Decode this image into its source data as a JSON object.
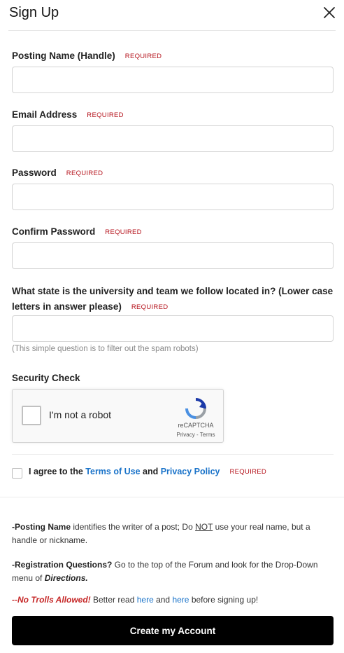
{
  "dialog": {
    "title": "Sign Up"
  },
  "form": {
    "required_tag": "REQUIRED",
    "fields": [
      {
        "label": "Posting Name (Handle)",
        "value": "",
        "placeholder": ""
      },
      {
        "label": "Email Address",
        "value": "",
        "placeholder": ""
      },
      {
        "label": "Password",
        "value": "",
        "placeholder": ""
      },
      {
        "label": "Confirm Password",
        "value": "",
        "placeholder": ""
      },
      {
        "label_line1": "What state is the university and team we follow located in? (Lower case",
        "label_line2": "letters in answer please)",
        "value": "",
        "placeholder": "",
        "hint": "(This simple question is to filter out the spam robots)"
      }
    ],
    "security_check_label": "Security Check"
  },
  "recaptcha": {
    "label": "I'm not a robot",
    "brand": "reCAPTCHA",
    "privacy": "Privacy",
    "sep": " - ",
    "terms": "Terms"
  },
  "agree": {
    "prefix": "I agree to the ",
    "terms_link": "Terms of Use",
    "and": " and ",
    "privacy_link": "Privacy Policy",
    "required": "REQUIRED"
  },
  "notes": {
    "posting_name_bold": "-Posting Name",
    "posting_name_text1": " identifies the writer of a post; Do ",
    "posting_name_not": "NOT",
    "posting_name_text2": " use your real name, but a handle or nickname.",
    "registration_bold": "-Registration Questions?",
    "registration_text": " Go to the top of the Forum and look for the Drop-Down menu of ",
    "registration_directions": "Directions.",
    "trolls_bold": "--No Trolls Allowed!",
    "trolls_text1": " Better read ",
    "trolls_here1": "here",
    "trolls_and": " and ",
    "trolls_here2": "here",
    "trolls_text2": " before signing up!"
  },
  "actions": {
    "create_label": "Create my Account"
  },
  "colors": {
    "required": "#b5121b",
    "link": "#1a73c9",
    "troll": "#c62828",
    "button_bg": "#000000"
  }
}
